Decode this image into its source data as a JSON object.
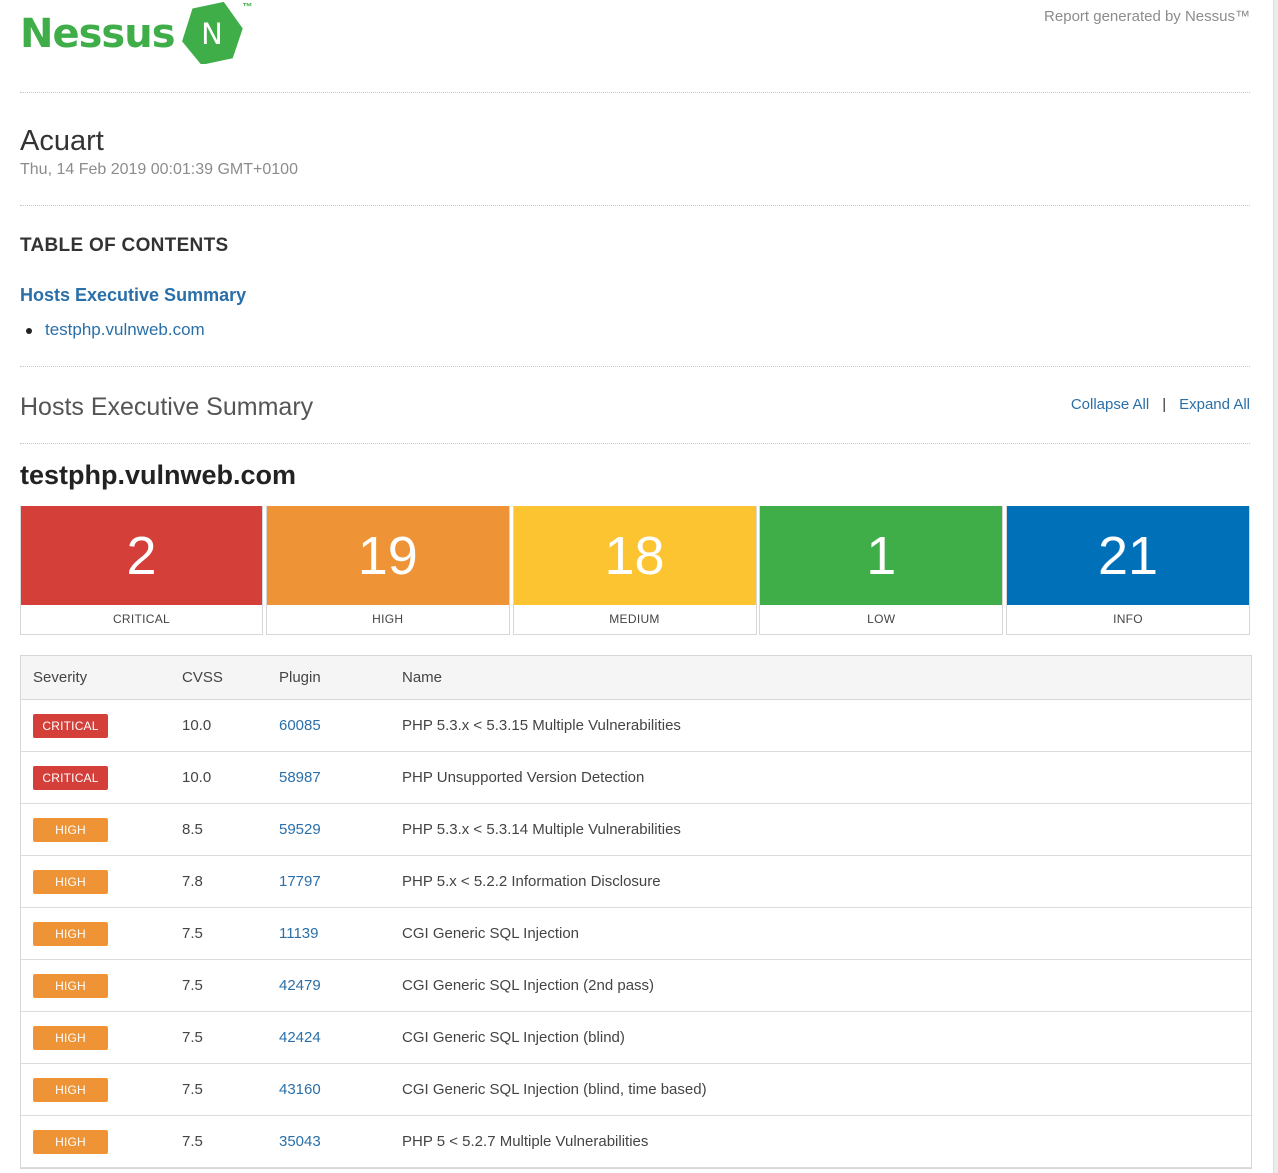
{
  "header": {
    "logo_text": "Nessus",
    "logo_letter": "N",
    "logo_tm": "™",
    "generated_by": "Report generated by Nessus™",
    "brand_color": "#3fae49"
  },
  "report": {
    "title": "Acuart",
    "date": "Thu, 14 Feb 2019 00:01:39 GMT+0100"
  },
  "toc": {
    "heading": "TABLE OF CONTENTS",
    "section_link": "Hosts Executive Summary",
    "hosts": [
      "testphp.vulnweb.com"
    ]
  },
  "summary": {
    "title": "Hosts Executive Summary",
    "collapse_all": "Collapse All",
    "separator": "|",
    "expand_all": "Expand All"
  },
  "host": {
    "name": "testphp.vulnweb.com",
    "counts": [
      {
        "label": "CRITICAL",
        "value": "2",
        "color": "#d43f3a"
      },
      {
        "label": "HIGH",
        "value": "19",
        "color": "#ee9336"
      },
      {
        "label": "MEDIUM",
        "value": "18",
        "color": "#fdc431"
      },
      {
        "label": "LOW",
        "value": "1",
        "color": "#3fae49"
      },
      {
        "label": "INFO",
        "value": "21",
        "color": "#0071b9"
      }
    ]
  },
  "table": {
    "headers": {
      "severity": "Severity",
      "cvss": "CVSS",
      "plugin": "Plugin",
      "name": "Name"
    },
    "rows": [
      {
        "severity": "CRITICAL",
        "cvss": "10.0",
        "plugin": "60085",
        "name": "PHP 5.3.x < 5.3.15 Multiple Vulnerabilities"
      },
      {
        "severity": "CRITICAL",
        "cvss": "10.0",
        "plugin": "58987",
        "name": "PHP Unsupported Version Detection"
      },
      {
        "severity": "HIGH",
        "cvss": "8.5",
        "plugin": "59529",
        "name": "PHP 5.3.x < 5.3.14 Multiple Vulnerabilities"
      },
      {
        "severity": "HIGH",
        "cvss": "7.8",
        "plugin": "17797",
        "name": "PHP 5.x < 5.2.2 Information Disclosure"
      },
      {
        "severity": "HIGH",
        "cvss": "7.5",
        "plugin": "11139",
        "name": "CGI Generic SQL Injection"
      },
      {
        "severity": "HIGH",
        "cvss": "7.5",
        "plugin": "42479",
        "name": "CGI Generic SQL Injection (2nd pass)"
      },
      {
        "severity": "HIGH",
        "cvss": "7.5",
        "plugin": "42424",
        "name": "CGI Generic SQL Injection (blind)"
      },
      {
        "severity": "HIGH",
        "cvss": "7.5",
        "plugin": "43160",
        "name": "CGI Generic SQL Injection (blind, time based)"
      },
      {
        "severity": "HIGH",
        "cvss": "7.5",
        "plugin": "35043",
        "name": "PHP 5 < 5.2.7 Multiple Vulnerabilities"
      }
    ]
  }
}
